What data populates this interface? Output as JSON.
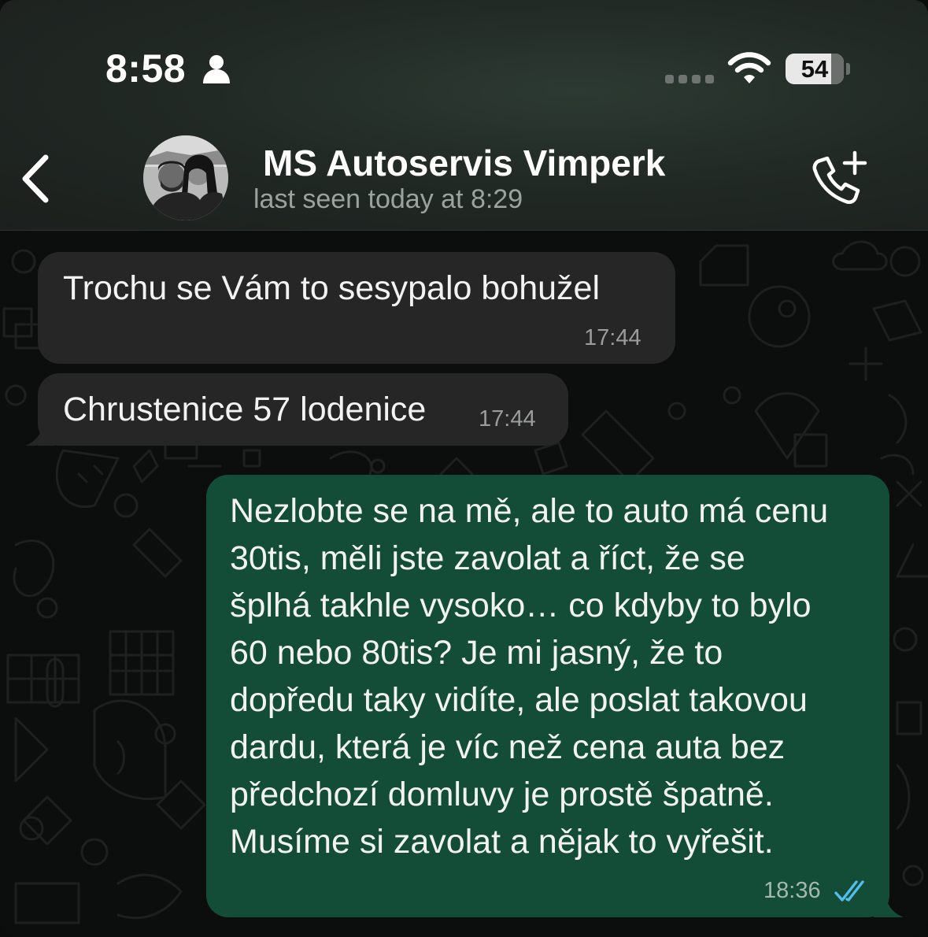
{
  "status_bar": {
    "time": "8:58",
    "battery_percent": "54",
    "icons": [
      "person-icon",
      "signal-dots-icon",
      "wifi-icon",
      "battery-icon"
    ]
  },
  "header": {
    "contact_name": "MS Autoservis Vimperk",
    "last_seen": "last seen today at 8:29",
    "icons": [
      "back-chevron-icon",
      "avatar",
      "add-call-icon"
    ]
  },
  "messages": [
    {
      "direction": "incoming",
      "text": "Trochu se Vám to sesypalo bohužel",
      "time": "17:44"
    },
    {
      "direction": "incoming",
      "text": "Chrustenice 57 lodenice",
      "time": "17:44"
    },
    {
      "direction": "outgoing",
      "lines": [
        "Nezlobte se na mě, ale to auto má cenu",
        "30tis, měli jste zavolat a říct, že se",
        "šplhá takhle vysoko… co kdyby to bylo",
        "60 nebo 80tis? Je mi jasný, že to",
        "dopředu taky vidíte, ale poslat takovou",
        "dardu, která je víc než cena auta bez",
        "předchozí domluvy je prostě špatně.",
        "Musíme si zavolat a nějak to vyřešit."
      ],
      "time": "18:36",
      "status": "read",
      "status_icon": "double-check-icon"
    }
  ],
  "colors": {
    "incoming_bubble": "#252625",
    "outgoing_bubble": "#144d37",
    "read_receipt": "#53bdeb",
    "chat_background": "#0c0d0d"
  }
}
